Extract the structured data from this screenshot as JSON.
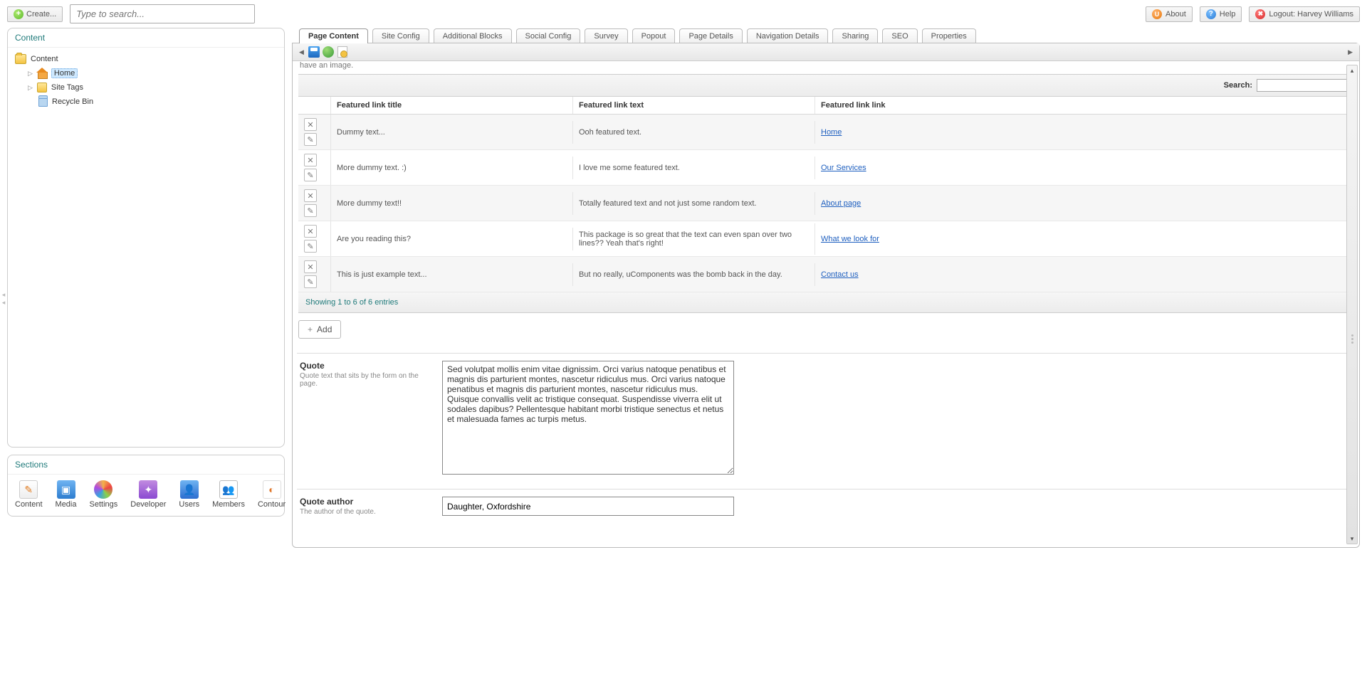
{
  "topbar": {
    "create": "Create...",
    "search_placeholder": "Type to search...",
    "about": "About",
    "help": "Help",
    "logout": "Logout: Harvey Williams"
  },
  "tree": {
    "panel_title": "Content",
    "root": "Content",
    "items": [
      "Home",
      "Site Tags",
      "Recycle Bin"
    ]
  },
  "sections": {
    "title": "Sections",
    "items": [
      "Content",
      "Media",
      "Settings",
      "Developer",
      "Users",
      "Members",
      "Contour"
    ]
  },
  "tabs": [
    "Page Content",
    "Site Config",
    "Additional Blocks",
    "Social Config",
    "Survey",
    "Popout",
    "Page Details",
    "Navigation Details",
    "Sharing",
    "SEO",
    "Properties"
  ],
  "content": {
    "description_tail": "have an image.",
    "grid": {
      "search_label": "Search:",
      "search_value": "",
      "columns": [
        "Featured link title",
        "Featured link text",
        "Featured link link"
      ],
      "rows": [
        {
          "title": "Dummy text...",
          "text": "Ooh featured text.",
          "link": "Home"
        },
        {
          "title": "More dummy text. :)",
          "text": "I love me some featured text.",
          "link": "Our Services"
        },
        {
          "title": "More dummy text!!",
          "text": "Totally featured text and not just some random text.",
          "link": "About page"
        },
        {
          "title": "Are you reading this?",
          "text": "This package is so great that the text can even span over two lines?? Yeah that's right!",
          "link": "What we look for"
        },
        {
          "title": "This is just example text...",
          "text": "But no really, uComponents was the bomb back in the day.",
          "link": "Contact us"
        }
      ],
      "footer": "Showing 1 to 6 of 6 entries",
      "add_label": "Add"
    },
    "quote": {
      "label": "Quote",
      "desc": "Quote text that sits by the form on the page.",
      "value": "Sed volutpat mollis enim vitae dignissim. Orci varius natoque penatibus et magnis dis parturient montes, nascetur ridiculus mus. Orci varius natoque penatibus et magnis dis parturient montes, nascetur ridiculus mus. Quisque convallis velit ac tristique consequat. Suspendisse viverra elit ut sodales dapibus? Pellentesque habitant morbi tristique senectus et netus et malesuada fames ac turpis metus."
    },
    "quote_author": {
      "label": "Quote author",
      "desc": "The author of the quote.",
      "value": "Daughter, Oxfordshire"
    }
  }
}
